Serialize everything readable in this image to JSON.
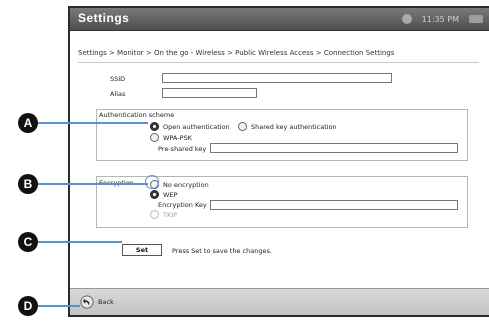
{
  "app": {
    "title": "Settings",
    "status_text": "11:35 PM"
  },
  "breadcrumb": "Settings > Monitor > On the go - Wireless > Public Wireless Access > Connection Settings",
  "ssid": {
    "label": "SSID",
    "value": ""
  },
  "alias": {
    "label": "Alias",
    "value": ""
  },
  "auth": {
    "group_label": "Authentication scheme",
    "options": [
      {
        "label": "Open authentication",
        "checked": true
      },
      {
        "label": "Shared key authentication",
        "checked": false
      },
      {
        "label": "WPA-PSK",
        "checked": false
      }
    ],
    "psk_label": "Pre-shared key",
    "psk_value": ""
  },
  "encryption": {
    "group_label": "Encryption",
    "options": [
      {
        "label": "No encryption",
        "checked": false
      },
      {
        "label": "WEP",
        "checked": true
      },
      {
        "label": "TKIP",
        "checked": false
      }
    ],
    "key_label": "Encryption Key",
    "key_value": ""
  },
  "set": {
    "button_label": "Set",
    "hint": "Press Set to save the changes."
  },
  "bottom": {
    "back_label": "Back"
  },
  "callouts": [
    "A",
    "B",
    "C",
    "D"
  ],
  "colors": {
    "callout_line": "#5b8fd6",
    "titlebar": "#5c5c5c"
  }
}
